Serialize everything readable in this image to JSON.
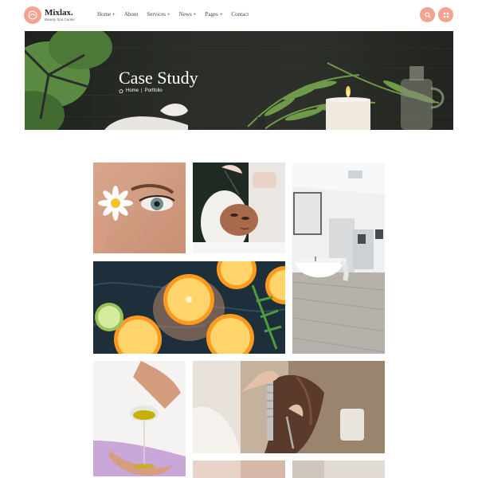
{
  "brand": {
    "name": "Mixlax.",
    "tagline": "Beauty Spa Center"
  },
  "nav": [
    {
      "label": "Home +"
    },
    {
      "label": "About"
    },
    {
      "label": "Services +"
    },
    {
      "label": "News +"
    },
    {
      "label": "Pages +"
    },
    {
      "label": "Contact"
    }
  ],
  "header_buttons": {
    "search_icon": "search-icon",
    "menu_icon": "grid-icon"
  },
  "banner": {
    "title": "Case Study",
    "breadcrumb": {
      "home": "Home",
      "separator": "|",
      "current": "Portfolio"
    }
  },
  "portfolio": {
    "items": [
      {
        "subject": "eye-daisy"
      },
      {
        "subject": "facial-mask"
      },
      {
        "subject": "bathroom"
      },
      {
        "subject": "citrus-water"
      },
      {
        "subject": "oil-pouring"
      },
      {
        "subject": "hair-cut"
      },
      {
        "subject": "partial-left"
      },
      {
        "subject": "partial-right"
      }
    ]
  },
  "colors": {
    "accent": "#f2a392",
    "banner_dark": "#24271f",
    "text": "#333333"
  }
}
